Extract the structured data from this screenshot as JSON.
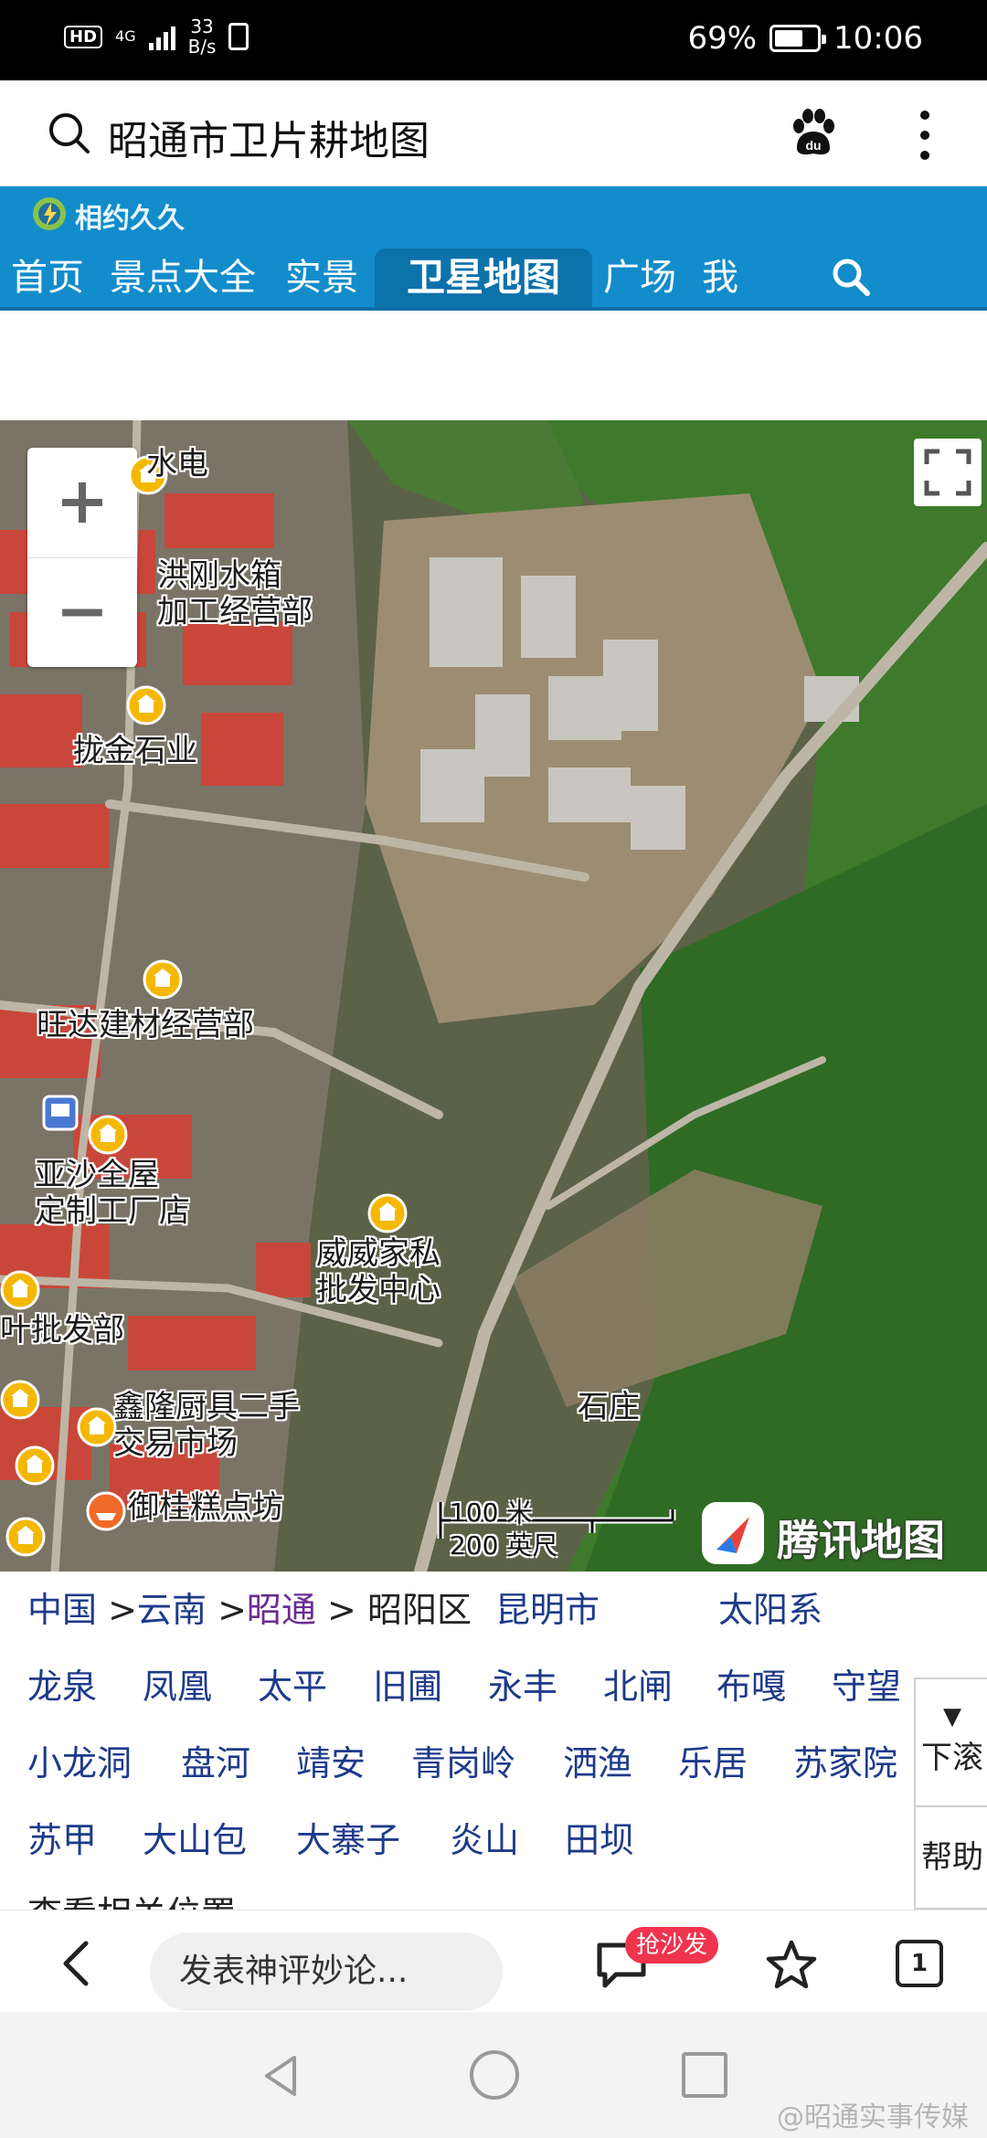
{
  "status_bar": {
    "hd": "HD",
    "network": "4G",
    "speed_value": "33",
    "speed_unit": "B/s",
    "battery_text": "69%",
    "battery_level": 0.69,
    "time": "10:06"
  },
  "browser": {
    "search_title": "昭通市卫片耕地图",
    "search_icon": "search-icon",
    "baidu_icon": "baidu-paw-icon",
    "menu_icon": "more-vertical-icon"
  },
  "site": {
    "logo_text": "相约久久",
    "nav": [
      {
        "label": "首页"
      },
      {
        "label": "景点大全"
      },
      {
        "label": "实景"
      },
      {
        "label": "卫星地图"
      },
      {
        "label": "广场"
      },
      {
        "label": "我"
      }
    ],
    "active_nav": "卫星地图",
    "accent_color": "#128ccb"
  },
  "map": {
    "zoom_in_icon": "plus-icon",
    "zoom_out_icon": "minus-icon",
    "fullscreen_icon": "fullscreen-icon",
    "labels": [
      {
        "text": "水电"
      },
      {
        "text": "洪刚水箱\n加工经营部"
      },
      {
        "text": "拢金石业"
      },
      {
        "text": "旺达建材经营部"
      },
      {
        "text": "亚沙全屋\n定制工厂店"
      },
      {
        "text": "威威家私\n批发中心"
      },
      {
        "text": "叶批发部"
      },
      {
        "text": "鑫隆厨具二手\n交易市场"
      },
      {
        "text": "御桂糕点坊"
      },
      {
        "text": "石庄"
      }
    ],
    "scale_metric": "100 米",
    "scale_imperial": "200 英尺",
    "brand": "腾讯地图"
  },
  "regions": {
    "breadcrumb": {
      "country": "中国",
      "sep1": ">",
      "province": "云南",
      "sep2": ">",
      "city": "昭通",
      "sep3": ">",
      "district": "昭阳区",
      "extra1": "昆明市",
      "extra2": "太阳系"
    },
    "row1": [
      "龙泉",
      "凤凰",
      "太平",
      "旧圃",
      "永丰",
      "北闸",
      "布嘎",
      "守望"
    ],
    "row2": [
      "小龙洞",
      "盘河",
      "靖安",
      "青岗岭",
      "洒渔",
      "乐居",
      "苏家院"
    ],
    "row3": [
      "苏甲",
      "大山包",
      "大寨子",
      "炎山",
      "田坝"
    ],
    "side_down_arrow": "▼",
    "side_down": "下滚",
    "side_help": "帮助",
    "cut_off_text": "查看相关位置"
  },
  "bottom_bar": {
    "comment_placeholder": "发表神评妙论...",
    "sofa_badge": "抢沙发",
    "tab_count": "1"
  },
  "watermark": "@昭通实事传媒"
}
